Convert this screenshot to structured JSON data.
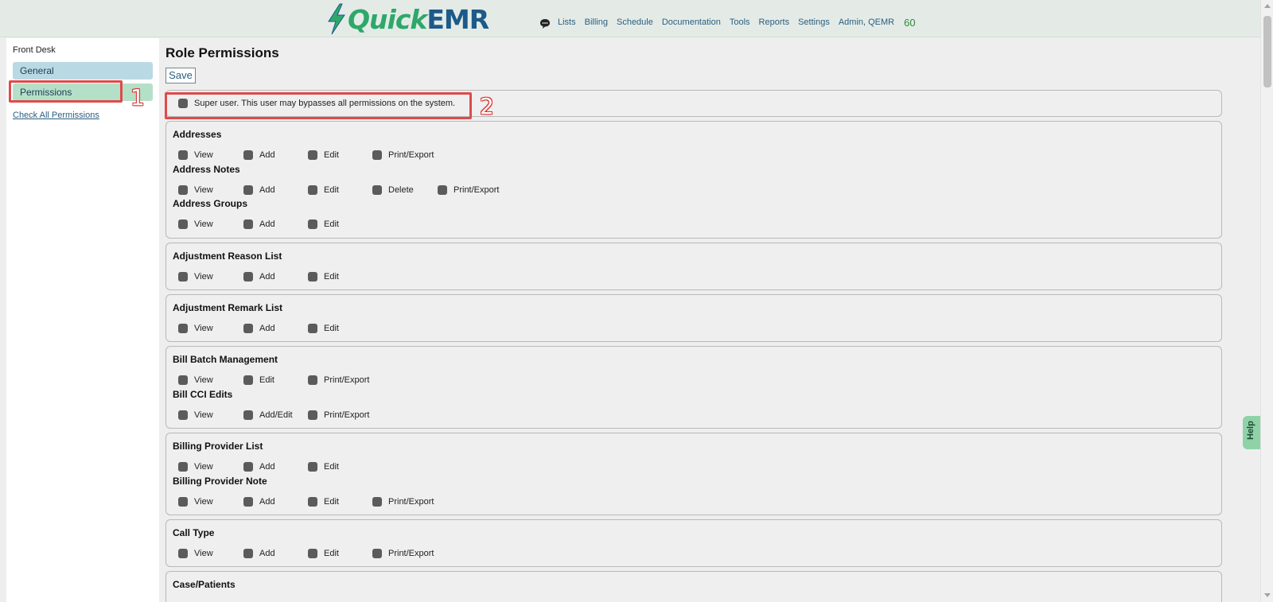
{
  "header": {
    "brand_quick": "Quick",
    "brand_emr": "EMR",
    "chat_icon": "speech-bubble-icon",
    "nav": [
      "Lists",
      "Billing",
      "Schedule",
      "Documentation",
      "Tools",
      "Reports",
      "Settings",
      "Admin, QEMR"
    ],
    "count": "60"
  },
  "sidebar": {
    "role": "Front Desk",
    "tabs": [
      "General",
      "Permissions"
    ],
    "check_all": "Check All Permissions"
  },
  "annotations": [
    "1",
    "2"
  ],
  "main": {
    "title": "Role Permissions",
    "save_label": "Save",
    "superuser": "Super user. This user may bypasses all permissions on the system."
  },
  "groups": [
    {
      "title": "Addresses",
      "options": [
        "View",
        "Add",
        "Edit",
        "Print/Export"
      ]
    },
    {
      "title": "Address Notes",
      "options": [
        "View",
        "Add",
        "Edit",
        "Delete",
        "Print/Export"
      ]
    },
    {
      "title": "Address Groups",
      "options": [
        "View",
        "Add",
        "Edit"
      ]
    },
    {
      "title": "Adjustment Reason List",
      "options": [
        "View",
        "Add",
        "Edit"
      ]
    },
    {
      "title": "Adjustment Remark List",
      "options": [
        "View",
        "Add",
        "Edit"
      ]
    },
    {
      "title": "Bill Batch Management",
      "options": [
        "View",
        "Edit",
        "Print/Export"
      ]
    },
    {
      "title": "Bill CCI Edits",
      "options": [
        "View",
        "Add/Edit",
        "Print/Export"
      ]
    },
    {
      "title": "Billing Provider List",
      "options": [
        "View",
        "Add",
        "Edit"
      ]
    },
    {
      "title": "Billing Provider Note",
      "options": [
        "View",
        "Add",
        "Edit",
        "Print/Export"
      ]
    },
    {
      "title": "Call Type",
      "options": [
        "View",
        "Add",
        "Edit",
        "Print/Export"
      ]
    },
    {
      "title": "Case/Patients",
      "options": []
    }
  ],
  "help": "Help",
  "colors": {
    "checkbox": "#5b5b5b",
    "tab_general": "#b9dae4",
    "tab_permissions": "#b5e0c8",
    "annotation": "#e04a4a"
  }
}
